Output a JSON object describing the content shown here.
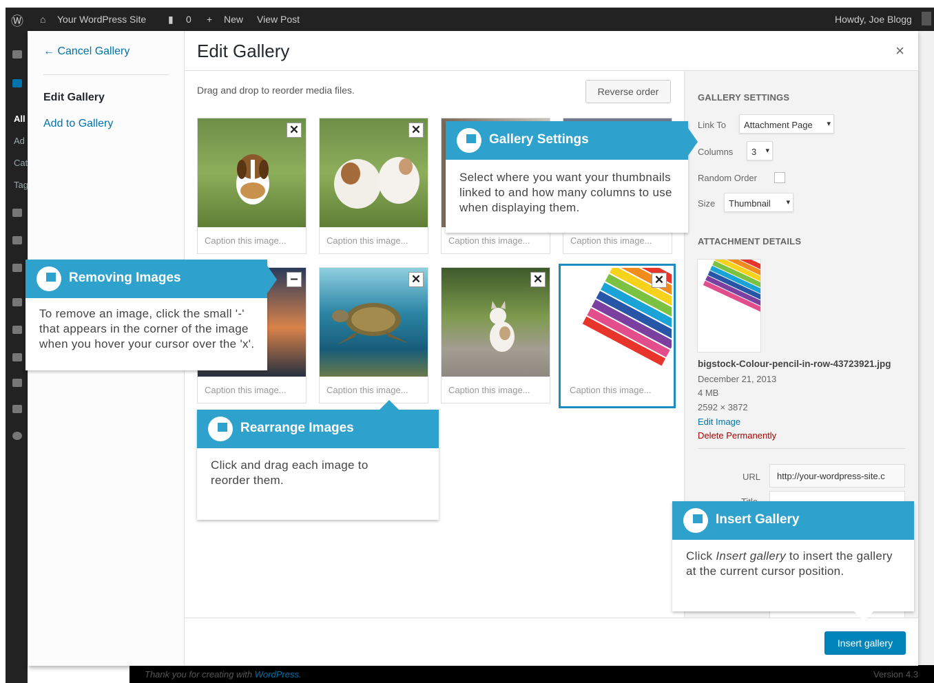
{
  "admin_bar": {
    "site_name": "Your WordPress Site",
    "comments_count": "0",
    "new_label": "New",
    "view_post": "View Post",
    "howdy": "Howdy, Joe Blogg"
  },
  "side_menu": {
    "all": "All",
    "add": "Ad",
    "cat": "Cat",
    "tag": "Tag"
  },
  "footer": {
    "thanks_prefix": "Thank you for creating with ",
    "thanks_link": "WordPress",
    "thanks_suffix": ".",
    "version": "Version 4.3"
  },
  "modal": {
    "cancel_label": "← Cancel Gallery",
    "menu_edit": "Edit Gallery",
    "menu_add": "Add to Gallery",
    "title": "Edit Gallery",
    "close": "×",
    "instructions": "Drag and drop to reorder media files.",
    "reverse_order": "Reverse order",
    "insert_gallery": "Insert gallery"
  },
  "attachments": [
    {
      "caption": "Caption this image...",
      "subject": "beagle puppy on grass"
    },
    {
      "caption": "Caption this image...",
      "subject": "bulldog puppies on grass"
    },
    {
      "caption": "Caption this image...",
      "subject": "photo"
    },
    {
      "caption": "Caption this image...",
      "subject": "photo"
    },
    {
      "caption": "Caption this image...",
      "subject": "pier at sunset"
    },
    {
      "caption": "Caption this image...",
      "subject": "sea turtle"
    },
    {
      "caption": "Caption this image...",
      "subject": "kitten on path"
    },
    {
      "caption": "Caption this image...",
      "subject": "colour pencils"
    }
  ],
  "gallery_settings": {
    "heading": "GALLERY SETTINGS",
    "link_to_label": "Link To",
    "link_to_value": "Attachment Page",
    "columns_label": "Columns",
    "columns_value": "3",
    "random_label": "Random Order",
    "size_label": "Size",
    "size_value": "Thumbnail"
  },
  "attachment_details": {
    "heading": "ATTACHMENT DETAILS",
    "filename": "bigstock-Colour-pencil-in-row-43723921.jpg",
    "date": "December 21, 2013",
    "filesize": "4 MB",
    "dimensions": "2592 × 3872",
    "edit_image": "Edit Image",
    "delete": "Delete Permanently",
    "url_label": "URL",
    "url_value": "http://your-wordpress-site.c",
    "title_label": "Title"
  },
  "callouts": {
    "gallery_settings": {
      "title": "Gallery Settings",
      "body": "Select where you want  your thumbnails linked to and how many columns to use when displaying them."
    },
    "removing": {
      "title": "Removing Images",
      "body": "To remove an image, click the small '-' that appears in the corner of the image when you hover your cursor over the 'x'."
    },
    "rearrange": {
      "title": "Rearrange Images",
      "body": "Click and drag each image to reorder them."
    },
    "insert": {
      "title": "Insert Gallery",
      "body_prefix": "Click ",
      "body_em": "Insert gallery",
      "body_suffix": " to insert the gallery at the current cursor position."
    }
  },
  "colors": {
    "accent": "#2ea2cc",
    "button": "#0085ba",
    "link": "#0073aa",
    "delete": "#a00"
  }
}
